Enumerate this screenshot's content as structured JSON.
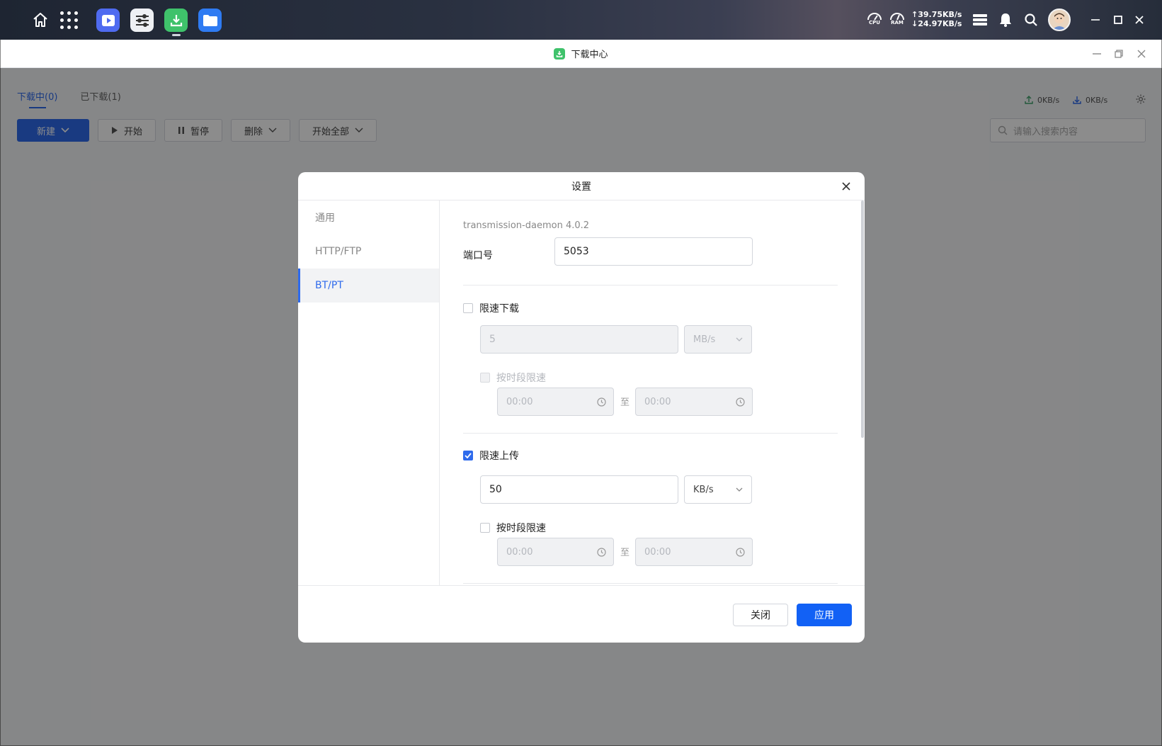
{
  "taskbar": {
    "cpu_label": "CPU",
    "ram_label": "RAM",
    "upload_rate": "↑39.75KB/s",
    "download_rate": "↓24.97KB/s",
    "apps": [
      "video-player",
      "settings",
      "download-center",
      "file-manager"
    ]
  },
  "window": {
    "title": "下载中心",
    "tabs": [
      {
        "label": "下载中(0)",
        "active": true
      },
      {
        "label": "已下载(1)",
        "active": false
      }
    ],
    "upload_speed": "0KB/s",
    "download_speed": "0KB/s",
    "toolbar": {
      "new_label": "新建",
      "start_label": "开始",
      "pause_label": "暂停",
      "delete_label": "删除",
      "start_all_label": "开始全部"
    },
    "search_placeholder": "请输入搜索内容"
  },
  "dialog": {
    "title": "设置",
    "sidebar": [
      {
        "label": "通用",
        "active": false
      },
      {
        "label": "HTTP/FTP",
        "active": false
      },
      {
        "label": "BT/PT",
        "active": true
      }
    ],
    "version": "transmission-daemon 4.0.2",
    "port_label": "端口号",
    "port_value": "5053",
    "download_limit": {
      "label": "限速下载",
      "checked": false,
      "value": "5",
      "unit": "MB/s",
      "schedule_label": "按时段限速",
      "schedule_checked": false,
      "from": "00:00",
      "to_sep": "至",
      "to": "00:00"
    },
    "upload_limit": {
      "label": "限速上传",
      "checked": true,
      "value": "50",
      "unit": "KB/s",
      "schedule_label": "按时段限速",
      "schedule_checked": false,
      "from": "00:00",
      "to_sep": "至",
      "to": "00:00"
    },
    "close_label": "关闭",
    "apply_label": "应用"
  },
  "colors": {
    "accent": "#2f6bec",
    "apply_button": "#1261f5",
    "download_app": "#3fc26b"
  }
}
